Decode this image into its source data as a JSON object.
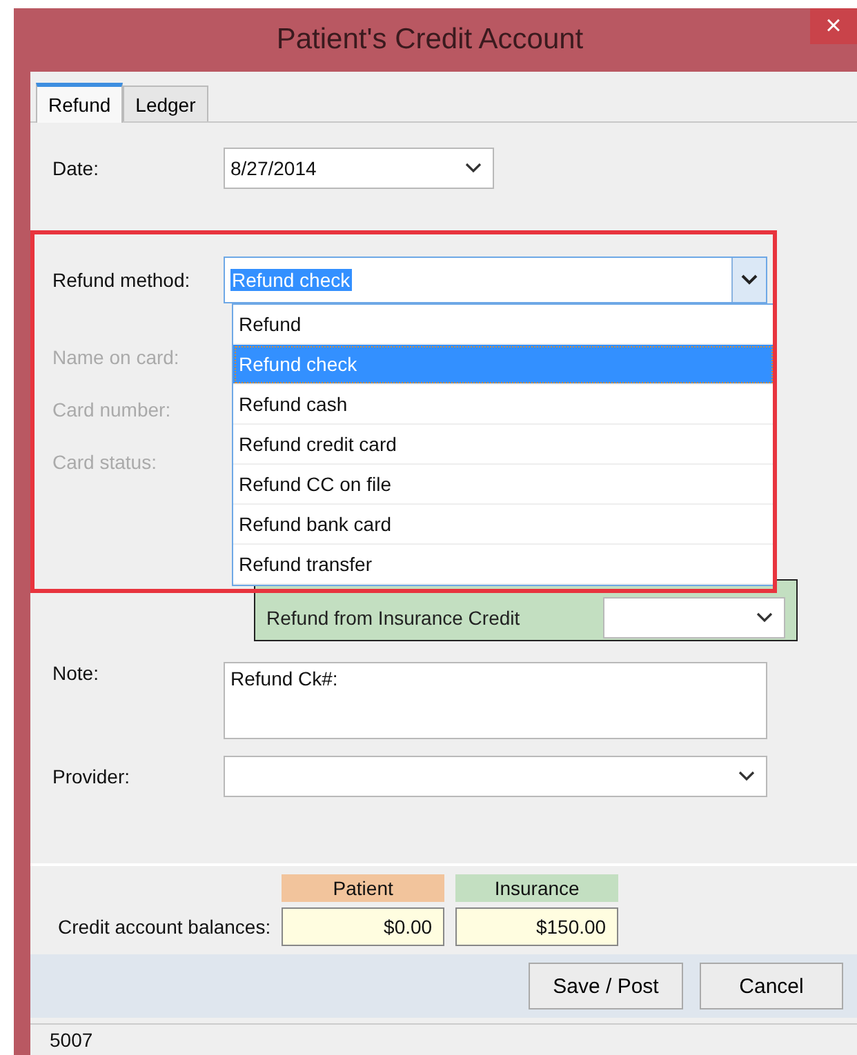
{
  "window": {
    "title": "Patient's Credit Account",
    "close": "×"
  },
  "tabs": [
    {
      "label": "Refund",
      "selected": true
    },
    {
      "label": "Ledger",
      "selected": false
    }
  ],
  "date": {
    "label": "Date:",
    "value": "8/27/2014"
  },
  "refund_method": {
    "label": "Refund method:",
    "value": "Refund check",
    "expanded": true,
    "options": [
      {
        "label": "Refund",
        "selected": false
      },
      {
        "label": "Refund check",
        "selected": true
      },
      {
        "label": "Refund cash",
        "selected": false
      },
      {
        "label": "Refund credit card",
        "selected": false
      },
      {
        "label": "Refund CC on file",
        "selected": false
      },
      {
        "label": "Refund bank card",
        "selected": false
      },
      {
        "label": "Refund transfer",
        "selected": false
      }
    ]
  },
  "card_fields": [
    {
      "label": "Name on card:",
      "disabled": true
    },
    {
      "label": "Card number:",
      "disabled": true
    },
    {
      "label": "Card status:",
      "disabled": true
    }
  ],
  "insurance_credit": {
    "label": "Refund from Insurance Credit"
  },
  "note": {
    "label": "Note:",
    "value": "Refund Ck#:"
  },
  "provider": {
    "label": "Provider:"
  },
  "balances": {
    "label": "Credit account balances:",
    "columns": [
      {
        "heading": "Patient",
        "value": "$0.00",
        "color": "#f2c49c"
      },
      {
        "heading": "Insurance",
        "value": "$150.00",
        "color": "#c3dfc1"
      }
    ]
  },
  "buttons": [
    "Save / Post",
    "Cancel"
  ],
  "status_bar": "5007"
}
